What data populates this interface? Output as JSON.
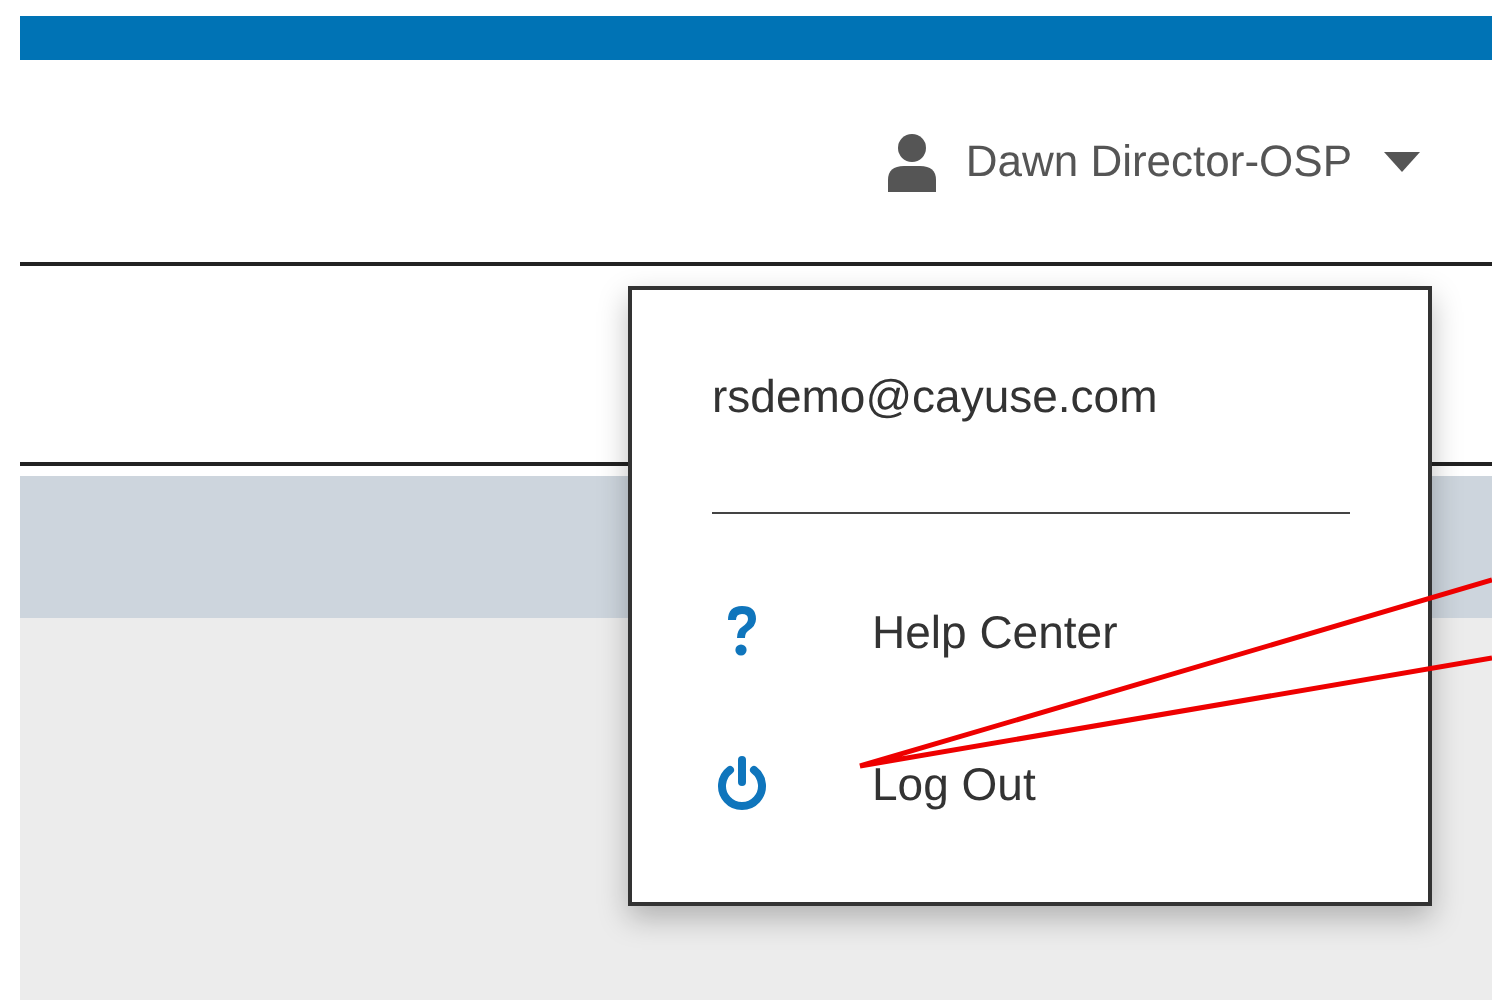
{
  "user_menu": {
    "name": "Dawn Director-OSP",
    "expanded": true
  },
  "dropdown": {
    "email": "rsdemo@cayuse.com",
    "items": [
      {
        "kind": "help",
        "label": "Help Center"
      },
      {
        "kind": "logout",
        "label": "Log Out"
      }
    ]
  }
}
